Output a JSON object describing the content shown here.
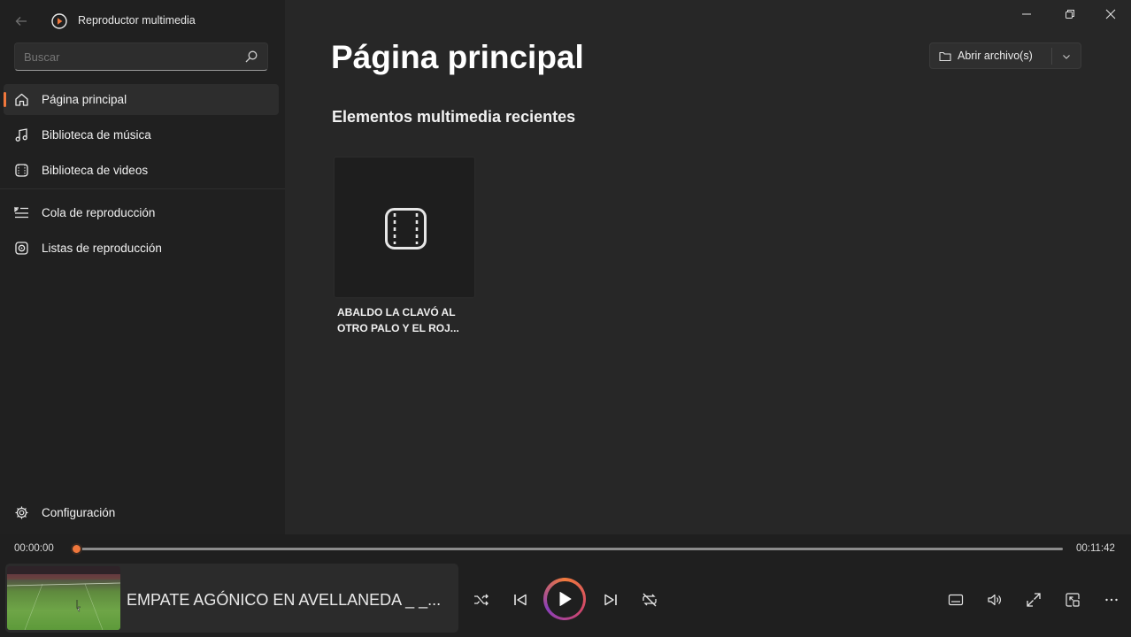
{
  "app": {
    "title": "Reproductor multimedia"
  },
  "search": {
    "placeholder": "Buscar"
  },
  "sidebar": {
    "items": [
      {
        "label": "Página principal",
        "icon": "home-icon",
        "active": true
      },
      {
        "label": "Biblioteca de música",
        "icon": "music-note-icon",
        "active": false
      },
      {
        "label": "Biblioteca de videos",
        "icon": "video-icon",
        "active": false
      },
      {
        "label": "Cola de reproducción",
        "icon": "queue-icon",
        "active": false
      },
      {
        "label": "Listas de reproducción",
        "icon": "playlist-icon",
        "active": false
      }
    ],
    "settings_label": "Configuración"
  },
  "main": {
    "title": "Página principal",
    "open_button_label": "Abrir archivo(s)",
    "section_title": "Elementos multimedia recientes",
    "recent": [
      {
        "caption_line1": "ABALDO LA CLAVÓ AL",
        "caption_line2": "OTRO PALO Y EL ROJ...",
        "icon": "video-frame-icon"
      }
    ]
  },
  "player": {
    "time_current": "00:00:00",
    "time_total": "00:11:42",
    "progress": 0.0,
    "now_playing_title": "EMPATE AGÓNICO EN AVELLANEDA _ _...",
    "accent": "#f0773c"
  },
  "colors": {
    "sidebar_bg": "#202020",
    "main_bg": "#272727",
    "player_bg": "#1f1f1f",
    "accent": "#f0773c"
  }
}
